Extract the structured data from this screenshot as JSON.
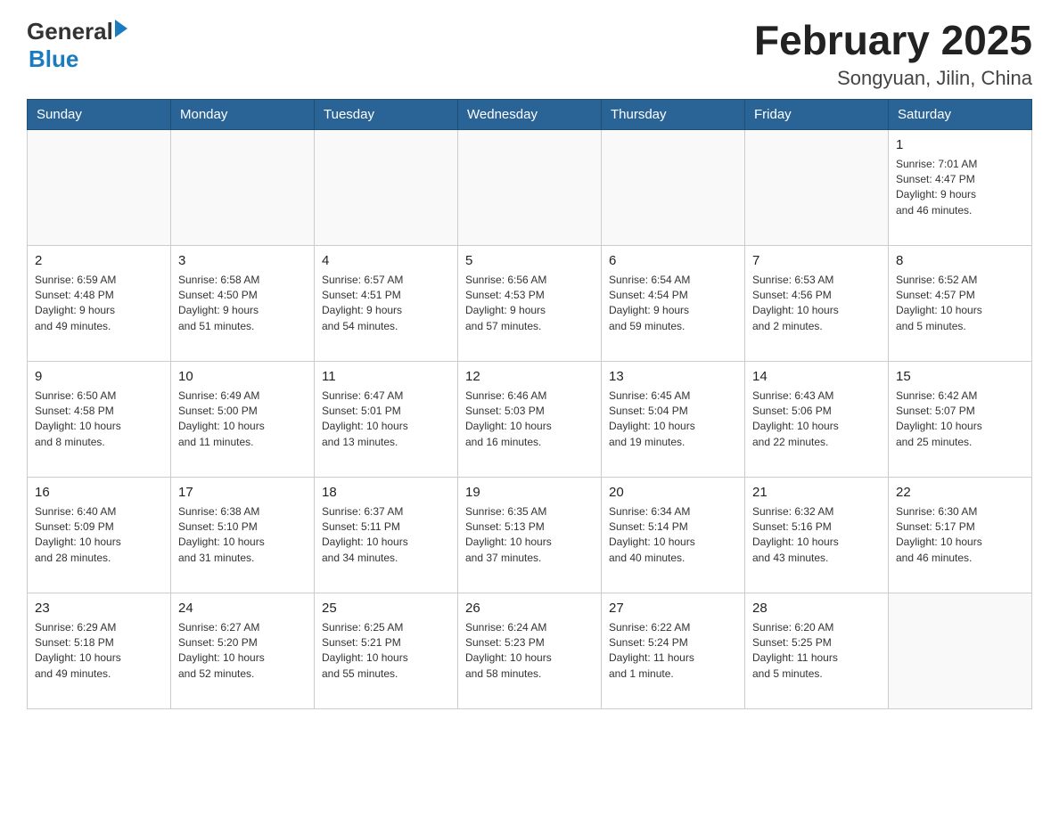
{
  "header": {
    "logo_general": "General",
    "logo_blue": "Blue",
    "month_title": "February 2025",
    "location": "Songyuan, Jilin, China"
  },
  "days_of_week": [
    "Sunday",
    "Monday",
    "Tuesday",
    "Wednesday",
    "Thursday",
    "Friday",
    "Saturday"
  ],
  "weeks": [
    [
      {
        "day": "",
        "info": ""
      },
      {
        "day": "",
        "info": ""
      },
      {
        "day": "",
        "info": ""
      },
      {
        "day": "",
        "info": ""
      },
      {
        "day": "",
        "info": ""
      },
      {
        "day": "",
        "info": ""
      },
      {
        "day": "1",
        "info": "Sunrise: 7:01 AM\nSunset: 4:47 PM\nDaylight: 9 hours\nand 46 minutes."
      }
    ],
    [
      {
        "day": "2",
        "info": "Sunrise: 6:59 AM\nSunset: 4:48 PM\nDaylight: 9 hours\nand 49 minutes."
      },
      {
        "day": "3",
        "info": "Sunrise: 6:58 AM\nSunset: 4:50 PM\nDaylight: 9 hours\nand 51 minutes."
      },
      {
        "day": "4",
        "info": "Sunrise: 6:57 AM\nSunset: 4:51 PM\nDaylight: 9 hours\nand 54 minutes."
      },
      {
        "day": "5",
        "info": "Sunrise: 6:56 AM\nSunset: 4:53 PM\nDaylight: 9 hours\nand 57 minutes."
      },
      {
        "day": "6",
        "info": "Sunrise: 6:54 AM\nSunset: 4:54 PM\nDaylight: 9 hours\nand 59 minutes."
      },
      {
        "day": "7",
        "info": "Sunrise: 6:53 AM\nSunset: 4:56 PM\nDaylight: 10 hours\nand 2 minutes."
      },
      {
        "day": "8",
        "info": "Sunrise: 6:52 AM\nSunset: 4:57 PM\nDaylight: 10 hours\nand 5 minutes."
      }
    ],
    [
      {
        "day": "9",
        "info": "Sunrise: 6:50 AM\nSunset: 4:58 PM\nDaylight: 10 hours\nand 8 minutes."
      },
      {
        "day": "10",
        "info": "Sunrise: 6:49 AM\nSunset: 5:00 PM\nDaylight: 10 hours\nand 11 minutes."
      },
      {
        "day": "11",
        "info": "Sunrise: 6:47 AM\nSunset: 5:01 PM\nDaylight: 10 hours\nand 13 minutes."
      },
      {
        "day": "12",
        "info": "Sunrise: 6:46 AM\nSunset: 5:03 PM\nDaylight: 10 hours\nand 16 minutes."
      },
      {
        "day": "13",
        "info": "Sunrise: 6:45 AM\nSunset: 5:04 PM\nDaylight: 10 hours\nand 19 minutes."
      },
      {
        "day": "14",
        "info": "Sunrise: 6:43 AM\nSunset: 5:06 PM\nDaylight: 10 hours\nand 22 minutes."
      },
      {
        "day": "15",
        "info": "Sunrise: 6:42 AM\nSunset: 5:07 PM\nDaylight: 10 hours\nand 25 minutes."
      }
    ],
    [
      {
        "day": "16",
        "info": "Sunrise: 6:40 AM\nSunset: 5:09 PM\nDaylight: 10 hours\nand 28 minutes."
      },
      {
        "day": "17",
        "info": "Sunrise: 6:38 AM\nSunset: 5:10 PM\nDaylight: 10 hours\nand 31 minutes."
      },
      {
        "day": "18",
        "info": "Sunrise: 6:37 AM\nSunset: 5:11 PM\nDaylight: 10 hours\nand 34 minutes."
      },
      {
        "day": "19",
        "info": "Sunrise: 6:35 AM\nSunset: 5:13 PM\nDaylight: 10 hours\nand 37 minutes."
      },
      {
        "day": "20",
        "info": "Sunrise: 6:34 AM\nSunset: 5:14 PM\nDaylight: 10 hours\nand 40 minutes."
      },
      {
        "day": "21",
        "info": "Sunrise: 6:32 AM\nSunset: 5:16 PM\nDaylight: 10 hours\nand 43 minutes."
      },
      {
        "day": "22",
        "info": "Sunrise: 6:30 AM\nSunset: 5:17 PM\nDaylight: 10 hours\nand 46 minutes."
      }
    ],
    [
      {
        "day": "23",
        "info": "Sunrise: 6:29 AM\nSunset: 5:18 PM\nDaylight: 10 hours\nand 49 minutes."
      },
      {
        "day": "24",
        "info": "Sunrise: 6:27 AM\nSunset: 5:20 PM\nDaylight: 10 hours\nand 52 minutes."
      },
      {
        "day": "25",
        "info": "Sunrise: 6:25 AM\nSunset: 5:21 PM\nDaylight: 10 hours\nand 55 minutes."
      },
      {
        "day": "26",
        "info": "Sunrise: 6:24 AM\nSunset: 5:23 PM\nDaylight: 10 hours\nand 58 minutes."
      },
      {
        "day": "27",
        "info": "Sunrise: 6:22 AM\nSunset: 5:24 PM\nDaylight: 11 hours\nand 1 minute."
      },
      {
        "day": "28",
        "info": "Sunrise: 6:20 AM\nSunset: 5:25 PM\nDaylight: 11 hours\nand 5 minutes."
      },
      {
        "day": "",
        "info": ""
      }
    ]
  ]
}
